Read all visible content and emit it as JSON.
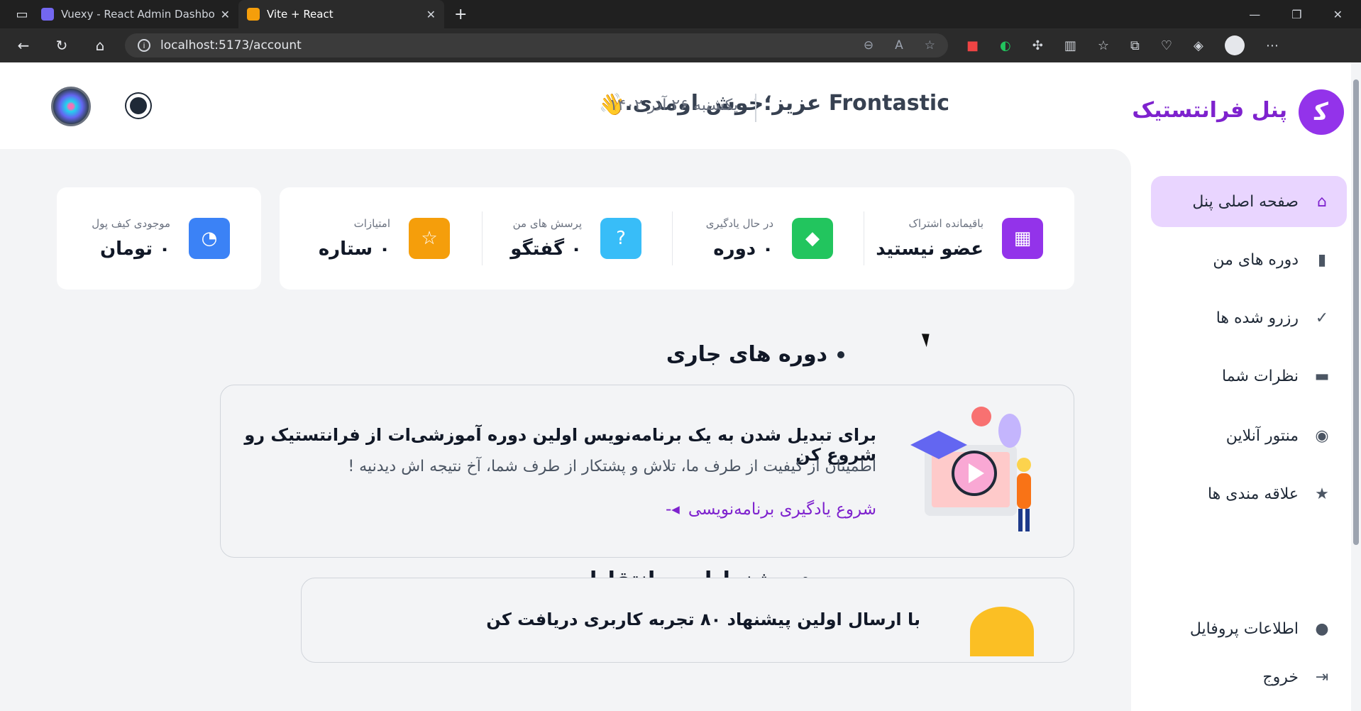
{
  "browser": {
    "tabs": [
      {
        "title": "Vuexy - React Admin Dashboard",
        "fav_color": "#7367f0"
      },
      {
        "title": "Vite + React",
        "fav_color": "#f59e0b"
      }
    ],
    "url": "localhost:5173/account"
  },
  "header": {
    "brand": "پنل فرانتستیک",
    "welcome": "Frontastic عزیز؛خوش اومدی.",
    "wave": "👋",
    "date": "یکشنبه ۲۶ آذر ۱۴۰۲"
  },
  "sidebar": {
    "items": [
      {
        "label": "صفحه اصلی پنل",
        "icon": "home-icon",
        "glyph": "⌂",
        "active": true
      },
      {
        "label": "دوره های من",
        "icon": "video-icon",
        "glyph": "▮",
        "active": false
      },
      {
        "label": "رزرو شده ها",
        "icon": "file-check-icon",
        "glyph": "✓",
        "active": false
      },
      {
        "label": "نظرات شما",
        "icon": "message-icon",
        "glyph": "▬",
        "active": false
      },
      {
        "label": "منتور آنلاین",
        "icon": "users-icon",
        "glyph": "◉",
        "active": false
      },
      {
        "label": "علاقه مندی ها",
        "icon": "star-folder-icon",
        "glyph": "★",
        "active": false
      },
      {
        "label": "اطلاعات پروفایل",
        "icon": "user-icon",
        "glyph": "●",
        "active": false
      },
      {
        "label": "خروج",
        "icon": "logout-icon",
        "glyph": "⇥",
        "active": false
      }
    ]
  },
  "stats": [
    {
      "label": "باقیمانده اشتراک",
      "value": "عضو نیستید",
      "icon": "calendar-icon",
      "glyph": "▦",
      "color": "#9333ea"
    },
    {
      "label": "در حال یادگیری",
      "value": "۰ دوره",
      "icon": "graduation-cap-icon",
      "glyph": "🎓",
      "color": "#22c55e"
    },
    {
      "label": "پرسش های من",
      "value": "۰ گفتگو",
      "icon": "question-icon",
      "glyph": "?",
      "color": "#38bdf8"
    },
    {
      "label": "امتیازات",
      "value": "۰ ستاره",
      "icon": "star-icon",
      "glyph": "☆",
      "color": "#f59e0b"
    }
  ],
  "wallet": {
    "label": "موجودی کیف پول",
    "value": "۰ تومان",
    "icon": "wallet-icon",
    "glyph": "◔",
    "color": "#3b82f6"
  },
  "sections": {
    "current_courses": "دوره های جاری",
    "suggestions": "پیشنهادات و انتقادات"
  },
  "banner": {
    "title": "برای تبدیل شدن به یک برنامه‌نویس اولین دوره آموزشی‌ات از فرانتستیک رو شروع کن",
    "subtitle": "اطمینان از کیفیت از طرف ما، تلاش و پشتکار از طرف شما، آخ نتیجه اش دیدنیه !",
    "link": "شروع یادگیری برنامه‌نویسی"
  },
  "banner2": {
    "title": "با ارسال اولین پیشنهاد ۸۰ تجربه کاربری دریافت کن"
  }
}
